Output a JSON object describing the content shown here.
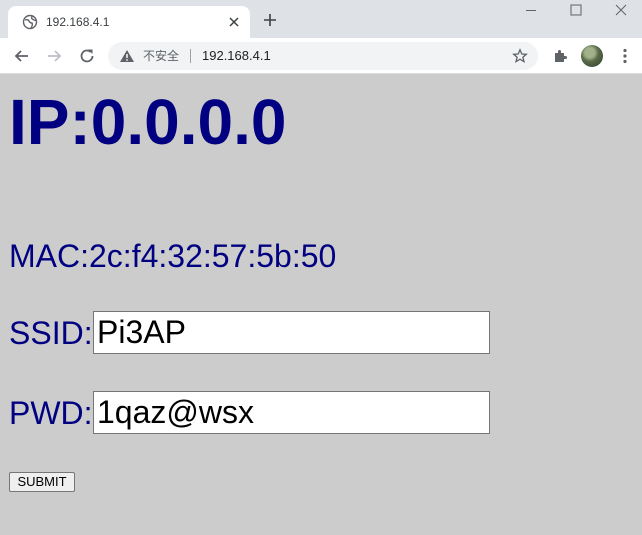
{
  "browser": {
    "tab_title": "192.168.4.1",
    "not_secure_label": "不安全",
    "url": "192.168.4.1",
    "theme": {
      "tabstrip_bg": "#dee1e6",
      "toolbar_bg": "#ffffff",
      "omnibox_bg": "#f1f3f4"
    },
    "icons": {
      "favicon": "globe-icon",
      "tab_close": "close-icon",
      "new_tab": "plus-icon",
      "back": "arrow-left-icon",
      "forward": "arrow-right-icon",
      "reload": "reload-icon",
      "security": "warning-icon",
      "bookmark": "star-icon",
      "extensions": "puzzle-icon",
      "menu": "kebab-menu-icon"
    }
  },
  "page": {
    "background": "#cccccc",
    "text_color": "#000080",
    "ip_heading": "IP:0.0.0.0",
    "mac": "MAC:2c:f4:32:57:5b:50",
    "ssid": {
      "label": "SSID:",
      "value": "Pi3AP"
    },
    "pwd": {
      "label": "PWD:",
      "value": "1qaz@wsx"
    },
    "submit_label": "SUBMIT"
  }
}
